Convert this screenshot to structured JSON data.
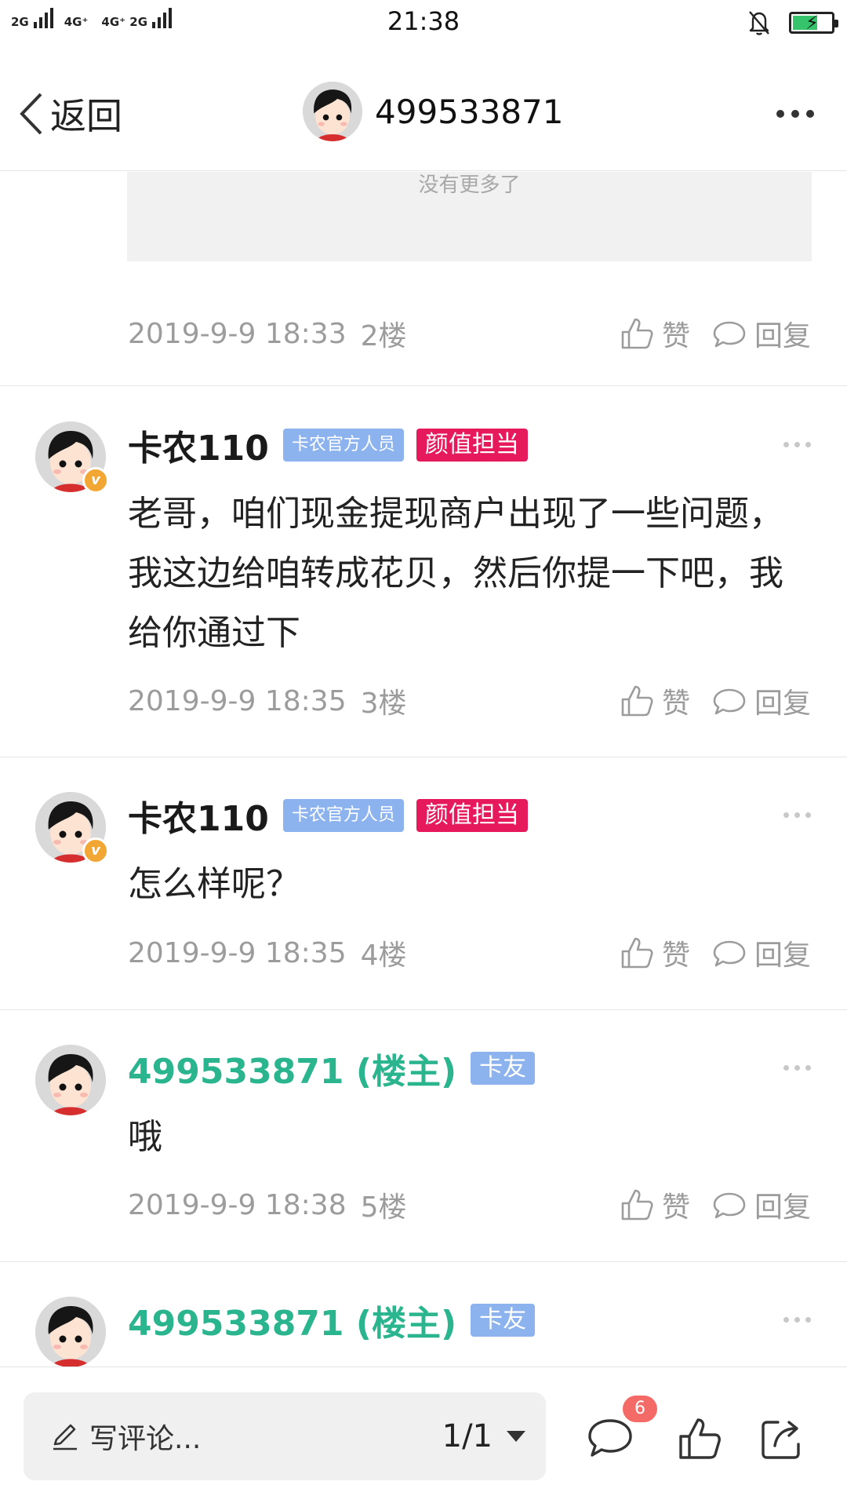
{
  "status_bar": {
    "signal_1": "2G",
    "signal_2": "4G⁺",
    "signal_3": "4G⁺ 2G",
    "time": "21:38"
  },
  "header": {
    "back_label": "返回",
    "title": "499533871"
  },
  "quote": {
    "text": "没有更多了"
  },
  "posts": [
    {
      "date": "2019-9-9 18:33",
      "floor": "2楼",
      "like_label": "赞",
      "reply_label": "回复"
    },
    {
      "author": "卡农110",
      "tag_role": "卡农官方人员",
      "tag_title": "颜值担当",
      "body": "老哥，咱们现金提现商户出现了一些问题，我这边给咱转成花贝，然后你提一下吧，我给你通过下",
      "date": "2019-9-9 18:35",
      "floor": "3楼",
      "like_label": "赞",
      "reply_label": "回复"
    },
    {
      "author": "卡农110",
      "tag_role": "卡农官方人员",
      "tag_title": "颜值担当",
      "body": "怎么样呢？",
      "date": "2019-9-9 18:35",
      "floor": "4楼",
      "like_label": "赞",
      "reply_label": "回复"
    },
    {
      "author": "499533871 (楼主)",
      "tag_role": "卡友",
      "body": "哦",
      "date": "2019-9-9 18:38",
      "floor": "5楼",
      "like_label": "赞",
      "reply_label": "回复"
    },
    {
      "author": "499533871 (楼主)",
      "tag_role": "卡友"
    }
  ],
  "bottom_bar": {
    "comment_placeholder": "写评论...",
    "page_indicator": "1/1",
    "comment_count": "6"
  },
  "colors": {
    "op_name": "#2bb58f",
    "tag_blue": "#8db3ee",
    "tag_pink": "#e5195c",
    "badge": "#f36a67",
    "verified_badge": "#f2a634"
  },
  "icons": [
    "back-chevron-icon",
    "more-icon",
    "thumbs-up-icon",
    "comment-bubble-icon",
    "pencil-icon",
    "dropdown-caret-icon",
    "share-icon",
    "verified-v-icon",
    "bell-muted-icon",
    "battery-charging-icon"
  ]
}
